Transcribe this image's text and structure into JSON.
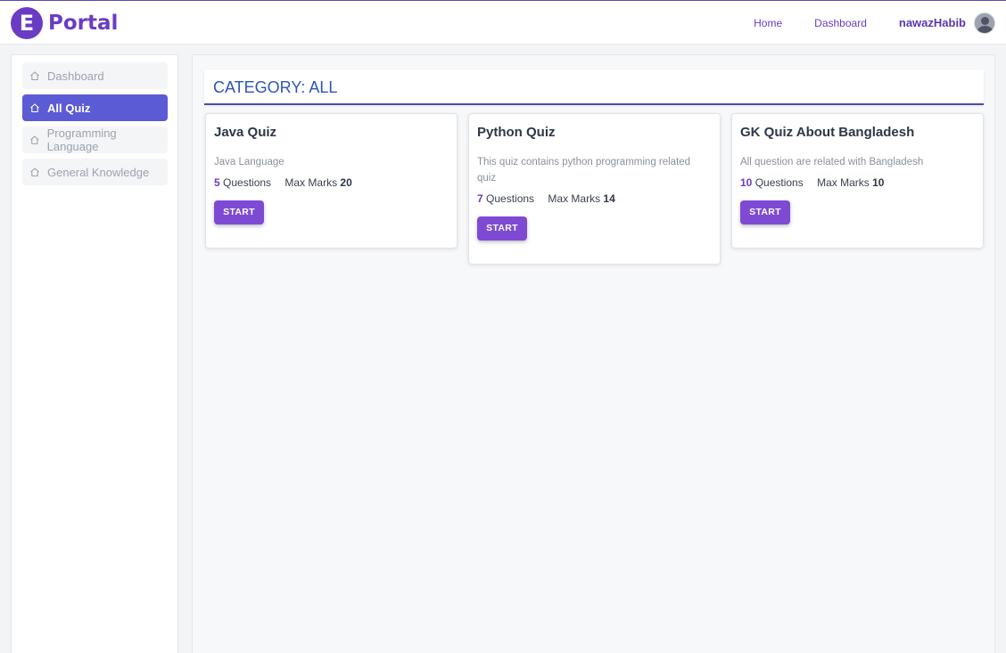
{
  "navbar": {
    "logo_letter": "E",
    "brand": "Portal",
    "links": [
      "Home",
      "Dashboard"
    ],
    "username": "nawazHabib"
  },
  "sidebar": {
    "items": [
      {
        "label": "Dashboard",
        "icon": "home-icon",
        "active": false
      },
      {
        "label": "All Quiz",
        "icon": "home-icon",
        "active": true
      },
      {
        "label": "Programming Language",
        "icon": "home-icon",
        "active": false
      },
      {
        "label": "General Knowledge",
        "icon": "home-icon",
        "active": false
      }
    ]
  },
  "main": {
    "category_title": "CATEGORY: ALL",
    "quizzes": [
      {
        "title": "Java Quiz",
        "description": "Java Language",
        "questions": "5",
        "questions_label": "Questions",
        "marks_label": "Max Marks",
        "max_marks": "20",
        "button": "START"
      },
      {
        "title": "Python Quiz",
        "description": "This quiz contains python programming related quiz",
        "questions": "7",
        "questions_label": "Questions",
        "marks_label": "Max Marks",
        "max_marks": "14",
        "button": "START"
      },
      {
        "title": "GK Quiz About Bangladesh",
        "description": "All question are related with Bangladesh",
        "questions": "10",
        "questions_label": "Questions",
        "marks_label": "Max Marks",
        "max_marks": "10",
        "button": "START"
      }
    ]
  },
  "colors": {
    "brand": "#6a3cc4",
    "active_sidebar": "#5b5bd6",
    "start_button": "#7e4ad4",
    "category_title": "#2f55b8"
  }
}
